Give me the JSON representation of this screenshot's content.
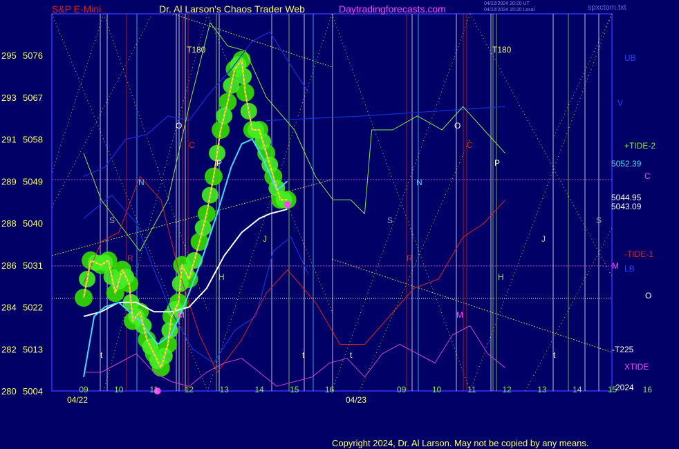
{
  "header": {
    "instrument": "S&P E-Mini",
    "title": "Dr. Al Larson's Chaos Trader Web",
    "site": "Daytradingforecasts.com",
    "ut_time": "04/22/2024 20:20 UT",
    "local_time": "04/22/2024 15:20 Local",
    "file": "spxctom.txt"
  },
  "copyright": "Copyright 2024, Dr. Al Larson. May not be copied by any means.",
  "colors": {
    "background": "#000066",
    "price_yellow": "#ffff00",
    "price_magenta": "#ff44ff",
    "green_blob": "#33dd00",
    "cyan_avg": "#44ddff",
    "white_avg": "#ffffff",
    "tide_green": "#88ee44",
    "tide_red": "#dd2222",
    "band_blue": "#0000cc",
    "xtide_magenta": "#cc44cc"
  },
  "chart_data": {
    "type": "line",
    "title": "S&P E-Mini",
    "x_labels": [
      "09",
      "10",
      "11",
      "12",
      "13",
      "14",
      "15",
      "16",
      "09",
      "10",
      "11",
      "12",
      "13",
      "14",
      "15",
      "16"
    ],
    "dates": [
      "04/22",
      "04/23"
    ],
    "ylim": [
      5004,
      5083
    ],
    "y_ticks": [
      {
        "code": "280",
        "price": "5004"
      },
      {
        "code": "282",
        "price": "5013"
      },
      {
        "code": "284",
        "price": "5022"
      },
      {
        "code": "286",
        "price": "5031"
      },
      {
        "code": "288",
        "price": "5040"
      },
      {
        "code": "289",
        "price": "5049"
      },
      {
        "code": "291",
        "price": "5058"
      },
      {
        "code": "293",
        "price": "5067"
      },
      {
        "code": "295",
        "price": "5076"
      }
    ],
    "right_labels": [
      {
        "text": "UB",
        "color": "#2244ff"
      },
      {
        "text": "V",
        "color": "#2244ff"
      },
      {
        "text": "+TIDE-2",
        "color": "#88ee44"
      },
      {
        "text": "5052.39",
        "color": "#44ddff"
      },
      {
        "text": "C",
        "color": "#ff44ff"
      },
      {
        "text": "5044.95",
        "color": "#ffffff"
      },
      {
        "text": "5043.09",
        "color": "#ffffff"
      },
      {
        "text": "-TIDE-1",
        "color": "#dd2222"
      },
      {
        "text": "M",
        "color": "#ff44ff"
      },
      {
        "text": "LB",
        "color": "#2244ff"
      },
      {
        "text": "O",
        "color": "#ffffff"
      },
      {
        "text": "-T225",
        "color": "#ffffff"
      },
      {
        "text": "XTIDE",
        "color": "#ff44ff"
      },
      {
        "text": "2024",
        "color": "#ffffff"
      }
    ],
    "markers": [
      {
        "text": "T180",
        "color": "#ffff66"
      },
      {
        "text": "T180",
        "color": "#ffff66"
      },
      {
        "text": "O",
        "color": "#ffffff"
      },
      {
        "text": "O",
        "color": "#ffffff"
      },
      {
        "text": "C",
        "color": "#dd2222"
      },
      {
        "text": "C",
        "color": "#dd2222"
      },
      {
        "text": "P",
        "color": "#ffffff"
      },
      {
        "text": "P",
        "color": "#ffffff"
      },
      {
        "text": "N",
        "color": "#44ddff"
      },
      {
        "text": "N",
        "color": "#44ddff"
      },
      {
        "text": "S",
        "color": "#aaaaaa"
      },
      {
        "text": "S",
        "color": "#aaaaaa"
      },
      {
        "text": "S",
        "color": "#aaaaaa"
      },
      {
        "text": "R",
        "color": "#dd2222"
      },
      {
        "text": "R",
        "color": "#dd2222"
      },
      {
        "text": "H",
        "color": "#88ee44"
      },
      {
        "text": "H",
        "color": "#88ee44"
      },
      {
        "text": "J",
        "color": "#88ee44"
      },
      {
        "text": "J",
        "color": "#88ee44"
      },
      {
        "text": "M",
        "color": "#ff44ff"
      },
      {
        "text": "M",
        "color": "#ff44ff"
      },
      {
        "text": "t",
        "color": "#ffffff"
      },
      {
        "text": "t",
        "color": "#ffffff"
      },
      {
        "text": "t",
        "color": "#ffffff"
      },
      {
        "text": "t",
        "color": "#ffffff"
      }
    ],
    "series": [
      {
        "name": "price",
        "values": [
          [
            0.0,
            5024
          ],
          [
            0.2,
            5032
          ],
          [
            0.5,
            5031
          ],
          [
            0.7,
            5032
          ],
          [
            0.9,
            5025
          ],
          [
            1.1,
            5030
          ],
          [
            1.3,
            5027
          ],
          [
            1.4,
            5019
          ],
          [
            1.6,
            5021
          ],
          [
            1.8,
            5015
          ],
          [
            2.0,
            5012
          ],
          [
            2.2,
            5009
          ],
          [
            2.4,
            5014
          ],
          [
            2.5,
            5020
          ],
          [
            2.7,
            5023
          ],
          [
            2.8,
            5031
          ],
          [
            3.0,
            5028
          ],
          [
            3.3,
            5036
          ],
          [
            3.5,
            5042
          ],
          [
            3.7,
            5050
          ],
          [
            3.9,
            5060
          ],
          [
            4.1,
            5066
          ],
          [
            4.3,
            5073
          ],
          [
            4.5,
            5075
          ],
          [
            4.6,
            5068
          ],
          [
            4.8,
            5060
          ],
          [
            5.0,
            5060
          ],
          [
            5.2,
            5055
          ],
          [
            5.4,
            5050
          ],
          [
            5.6,
            5045
          ],
          [
            5.8,
            5045
          ]
        ]
      },
      {
        "name": "avg_fast",
        "values": [
          [
            0.0,
            5007
          ],
          [
            0.3,
            5020
          ],
          [
            0.6,
            5022
          ],
          [
            1.0,
            5023
          ],
          [
            1.6,
            5019
          ],
          [
            2.1,
            5014
          ],
          [
            2.5,
            5016
          ],
          [
            3.0,
            5025
          ],
          [
            3.4,
            5033
          ],
          [
            3.8,
            5042
          ],
          [
            4.2,
            5052
          ],
          [
            4.5,
            5057
          ],
          [
            4.8,
            5058
          ],
          [
            5.1,
            5054
          ],
          [
            5.5,
            5047
          ],
          [
            5.8,
            5049
          ]
        ]
      },
      {
        "name": "avg_slow",
        "values": [
          [
            0.0,
            5020
          ],
          [
            0.5,
            5021
          ],
          [
            1.0,
            5023
          ],
          [
            1.5,
            5023
          ],
          [
            2.0,
            5021
          ],
          [
            2.5,
            5021
          ],
          [
            3.0,
            5022
          ],
          [
            3.5,
            5026
          ],
          [
            4.0,
            5033
          ],
          [
            4.5,
            5038
          ],
          [
            5.0,
            5041
          ],
          [
            5.3,
            5042
          ],
          [
            5.8,
            5043
          ]
        ]
      },
      {
        "name": "+TIDE-2",
        "values": [
          [
            0.0,
            5055
          ],
          [
            0.5,
            5045
          ],
          [
            1.0,
            5040
          ],
          [
            1.6,
            5034
          ],
          [
            2.4,
            5045
          ],
          [
            3.0,
            5065
          ],
          [
            3.6,
            5083
          ],
          [
            4.1,
            5078
          ],
          [
            4.6,
            5077
          ],
          [
            5.2,
            5067
          ],
          [
            6.0,
            5060
          ],
          [
            6.6,
            5050
          ],
          [
            7.1,
            5045
          ],
          [
            7.6,
            5045
          ],
          [
            8.0,
            5042
          ],
          [
            8.2,
            5060
          ],
          [
            8.8,
            5060
          ],
          [
            9.5,
            5063
          ],
          [
            10.2,
            5060
          ],
          [
            10.8,
            5065
          ],
          [
            11.4,
            5060
          ],
          [
            12.0,
            5055
          ]
        ]
      },
      {
        "name": "-TIDE-1",
        "values": [
          [
            0.0,
            5027
          ],
          [
            0.5,
            5036
          ],
          [
            1.0,
            5038
          ],
          [
            1.6,
            5050
          ],
          [
            2.2,
            5045
          ],
          [
            2.7,
            5030
          ],
          [
            3.3,
            5016
          ],
          [
            3.8,
            5008
          ],
          [
            4.5,
            5015
          ],
          [
            5.2,
            5025
          ],
          [
            5.8,
            5030
          ],
          [
            6.6,
            5023
          ],
          [
            7.3,
            5014
          ],
          [
            8.0,
            5014
          ],
          [
            8.7,
            5020
          ],
          [
            9.4,
            5026
          ],
          [
            10.1,
            5028
          ],
          [
            10.8,
            5037
          ],
          [
            11.4,
            5040
          ],
          [
            12.0,
            5045
          ]
        ]
      },
      {
        "name": "XTIDE",
        "values": [
          [
            0.0,
            5008
          ],
          [
            0.5,
            5008
          ],
          [
            1.0,
            5010
          ],
          [
            1.5,
            5012
          ],
          [
            2.0,
            5008
          ],
          [
            2.5,
            5006
          ],
          [
            3.0,
            5005
          ],
          [
            3.5,
            5008
          ],
          [
            4.0,
            5010
          ],
          [
            4.5,
            5011
          ],
          [
            5.0,
            5008
          ],
          [
            5.5,
            5005
          ],
          [
            6.0,
            5006
          ],
          [
            6.5,
            5007
          ],
          [
            7.0,
            5010
          ],
          [
            7.5,
            5011
          ],
          [
            8.0,
            5007
          ],
          [
            8.5,
            5012
          ],
          [
            9.0,
            5014
          ],
          [
            9.5,
            5012
          ],
          [
            10.0,
            5010
          ],
          [
            10.5,
            5016
          ],
          [
            11.0,
            5018
          ],
          [
            11.5,
            5012
          ],
          [
            12.0,
            5009
          ]
        ]
      },
      {
        "name": "UB",
        "values": [
          [
            0.0,
            5050
          ],
          [
            0.6,
            5052
          ],
          [
            1.2,
            5058
          ],
          [
            1.8,
            5059
          ],
          [
            2.4,
            5063
          ],
          [
            3.0,
            5062
          ],
          [
            3.6,
            5068
          ],
          [
            4.2,
            5073
          ],
          [
            4.8,
            5079
          ],
          [
            5.3,
            5081
          ],
          [
            5.8,
            5075
          ],
          [
            6.4,
            5068
          ]
        ]
      },
      {
        "name": "LB",
        "values": [
          [
            0.0,
            5041
          ],
          [
            0.8,
            5046
          ],
          [
            1.5,
            5040
          ],
          [
            2.0,
            5030
          ],
          [
            2.5,
            5021
          ],
          [
            3.1,
            5013
          ],
          [
            3.7,
            5010
          ],
          [
            4.3,
            5017
          ],
          [
            4.9,
            5020
          ],
          [
            5.4,
            5034
          ],
          [
            5.9,
            5037
          ],
          [
            6.4,
            5029
          ]
        ]
      },
      {
        "name": "V",
        "values": [
          [
            5.2,
            5062
          ],
          [
            8.0,
            5063
          ],
          [
            12.0,
            5065
          ]
        ]
      }
    ]
  }
}
